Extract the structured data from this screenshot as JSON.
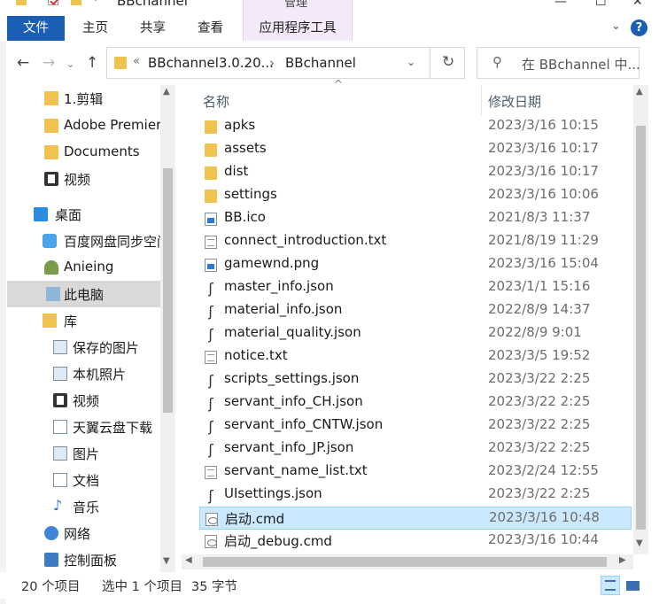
{
  "window": {
    "title": "BBchannel",
    "manage_caption": "管理"
  },
  "ribbon": {
    "tabs": [
      "文件",
      "主页",
      "共享",
      "查看",
      "应用程序工具"
    ]
  },
  "nav": {
    "address_crumbs": [
      "«",
      "BBchannel3.0.20...",
      "›",
      "BBchannel"
    ],
    "search_placeholder": "在 BBchannel 中..."
  },
  "navpane": {
    "items": [
      {
        "label": "1.剪辑",
        "icon": "folder-icon"
      },
      {
        "label": "Adobe Premier",
        "icon": "folder-icon"
      },
      {
        "label": "Documents",
        "icon": "folder-icon"
      },
      {
        "label": "视频",
        "icon": "video-icon"
      },
      {
        "label": "桌面",
        "icon": "desktop-icon"
      },
      {
        "label": "百度网盘同步空间",
        "icon": "cloud-sync-icon"
      },
      {
        "label": "Anieing",
        "icon": "user-icon"
      },
      {
        "label": "此电脑",
        "icon": "computer-icon",
        "selected": true
      },
      {
        "label": "库",
        "icon": "library-icon"
      },
      {
        "label": "保存的图片",
        "icon": "pictures-icon"
      },
      {
        "label": "本机照片",
        "icon": "pictures-icon"
      },
      {
        "label": "视频",
        "icon": "video-icon"
      },
      {
        "label": "天翼云盘下载",
        "icon": "document-icon"
      },
      {
        "label": "图片",
        "icon": "pictures-icon"
      },
      {
        "label": "文档",
        "icon": "document-icon"
      },
      {
        "label": "音乐",
        "icon": "music-icon"
      },
      {
        "label": "网络",
        "icon": "network-icon"
      },
      {
        "label": "控制面板",
        "icon": "control-panel-icon"
      }
    ]
  },
  "filelist": {
    "columns": {
      "name": "名称",
      "date": "修改日期"
    },
    "files": [
      {
        "name": "apks",
        "date": "2023/3/16 10:15",
        "type": "folder"
      },
      {
        "name": "assets",
        "date": "2023/3/16 10:17",
        "type": "folder"
      },
      {
        "name": "dist",
        "date": "2023/3/16 10:17",
        "type": "folder"
      },
      {
        "name": "settings",
        "date": "2023/3/16 10:06",
        "type": "folder"
      },
      {
        "name": "BB.ico",
        "date": "2021/8/3 11:37",
        "type": "image"
      },
      {
        "name": "connect_introduction.txt",
        "date": "2021/8/19 11:29",
        "type": "text"
      },
      {
        "name": "gamewnd.png",
        "date": "2023/3/16 15:04",
        "type": "image"
      },
      {
        "name": "master_info.json",
        "date": "2023/1/1 15:16",
        "type": "json"
      },
      {
        "name": "material_info.json",
        "date": "2022/8/9 14:37",
        "type": "json"
      },
      {
        "name": "material_quality.json",
        "date": "2022/8/9 9:01",
        "type": "json"
      },
      {
        "name": "notice.txt",
        "date": "2023/3/5 19:52",
        "type": "text"
      },
      {
        "name": "scripts_settings.json",
        "date": "2023/3/22 2:25",
        "type": "json"
      },
      {
        "name": "servant_info_CH.json",
        "date": "2023/3/22 2:25",
        "type": "json"
      },
      {
        "name": "servant_info_CNTW.json",
        "date": "2023/3/22 2:25",
        "type": "json"
      },
      {
        "name": "servant_info_JP.json",
        "date": "2023/3/22 2:25",
        "type": "json"
      },
      {
        "name": "servant_name_list.txt",
        "date": "2023/2/24 12:55",
        "type": "text"
      },
      {
        "name": "UIsettings.json",
        "date": "2023/3/22 2:25",
        "type": "json"
      },
      {
        "name": "启动.cmd",
        "date": "2023/3/16 10:48",
        "type": "cmd",
        "selected": true
      },
      {
        "name": "启动_debug.cmd",
        "date": "2023/3/16 10:44",
        "type": "cmd"
      }
    ]
  },
  "status": {
    "count": "20 个项目",
    "selection": "选中 1 个项目",
    "size": "35 字节"
  },
  "colors": {
    "accent": "#1a5fb4",
    "selection_bg": "#cce8ff",
    "manage_tab_bg": "#f3e9f8"
  }
}
